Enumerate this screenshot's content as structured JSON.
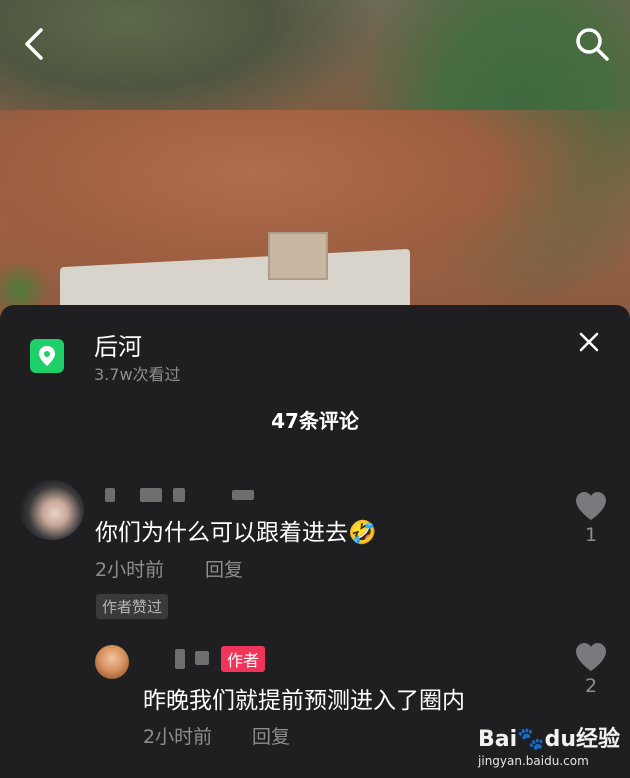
{
  "location": {
    "name": "后河",
    "views": "3.7w次看过"
  },
  "comments_header": {
    "count_label": "47条评论"
  },
  "comments": [
    {
      "text": "你们为什么可以跟着进去🤣",
      "time": "2小时前",
      "reply_label": "回复",
      "liked_by_author_label": "作者赞过",
      "likes": "1"
    }
  ],
  "replies": [
    {
      "author_tag": "作者",
      "text": "昨晚我们就提前预测进入了圈内",
      "time": "2小时前",
      "reply_label": "回复",
      "likes": "2"
    }
  ],
  "watermark": {
    "logo": "Bai🐾du经验",
    "url": "jingyan.baidu.com"
  },
  "colors": {
    "panel_bg": "#1f1f21",
    "location_icon": "#1fcf6a",
    "author_tag": "#f0355a",
    "muted_text": "#8d8d92"
  },
  "icons": [
    "back-arrow-icon",
    "search-icon",
    "location-pin-icon",
    "close-icon",
    "heart-icon"
  ]
}
